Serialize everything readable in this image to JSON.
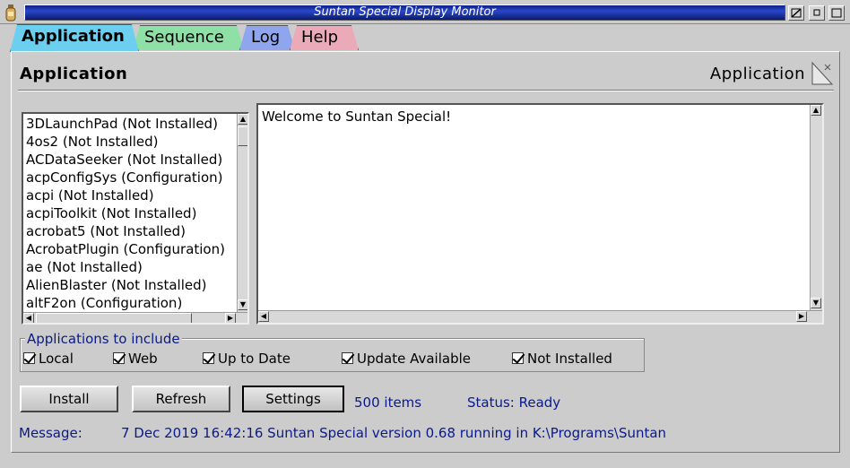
{
  "window": {
    "title": "Suntan Special Display Monitor"
  },
  "tabs": [
    {
      "label": "Application",
      "active": true
    },
    {
      "label": "Sequence"
    },
    {
      "label": "Log"
    },
    {
      "label": "Help"
    }
  ],
  "header": {
    "title": "Application",
    "right_label": "Application"
  },
  "app_list": {
    "items": [
      "3DLaunchPad (Not Installed)",
      "4os2 (Not Installed)",
      "ACDataSeeker (Not Installed)",
      "acpConfigSys (Configuration)",
      "acpi (Not Installed)",
      "acpiToolkit (Not Installed)",
      "acrobat5 (Not Installed)",
      "AcrobatPlugin (Configuration)",
      "ae (Not Installed)",
      "AlienBlaster (Not Installed)",
      "altF2on (Configuration)"
    ]
  },
  "output": {
    "text": "Welcome to Suntan Special!"
  },
  "filters": {
    "title": "Applications to include",
    "options": [
      {
        "label": "Local",
        "checked": true
      },
      {
        "label": "Web",
        "checked": true
      },
      {
        "label": "Up to Date",
        "checked": true
      },
      {
        "label": "Update Available",
        "checked": true
      },
      {
        "label": "Not Installed",
        "checked": true
      }
    ]
  },
  "actions": {
    "install_label": "Install",
    "refresh_label": "Refresh",
    "settings_label": "Settings"
  },
  "status": {
    "items_count": "500 items",
    "status_text": "Status: Ready"
  },
  "message": {
    "label": "Message:",
    "text": "7 Dec 2019 16:42:16 Suntan Special version 0.68 running in K:\\Programs\\Suntan"
  },
  "colors": {
    "accent_text": "#0a1a8a",
    "tab_application": "#6ccff0",
    "tab_sequence": "#8fe0a6",
    "tab_log": "#8fa6ee",
    "tab_help": "#eaaab8"
  }
}
